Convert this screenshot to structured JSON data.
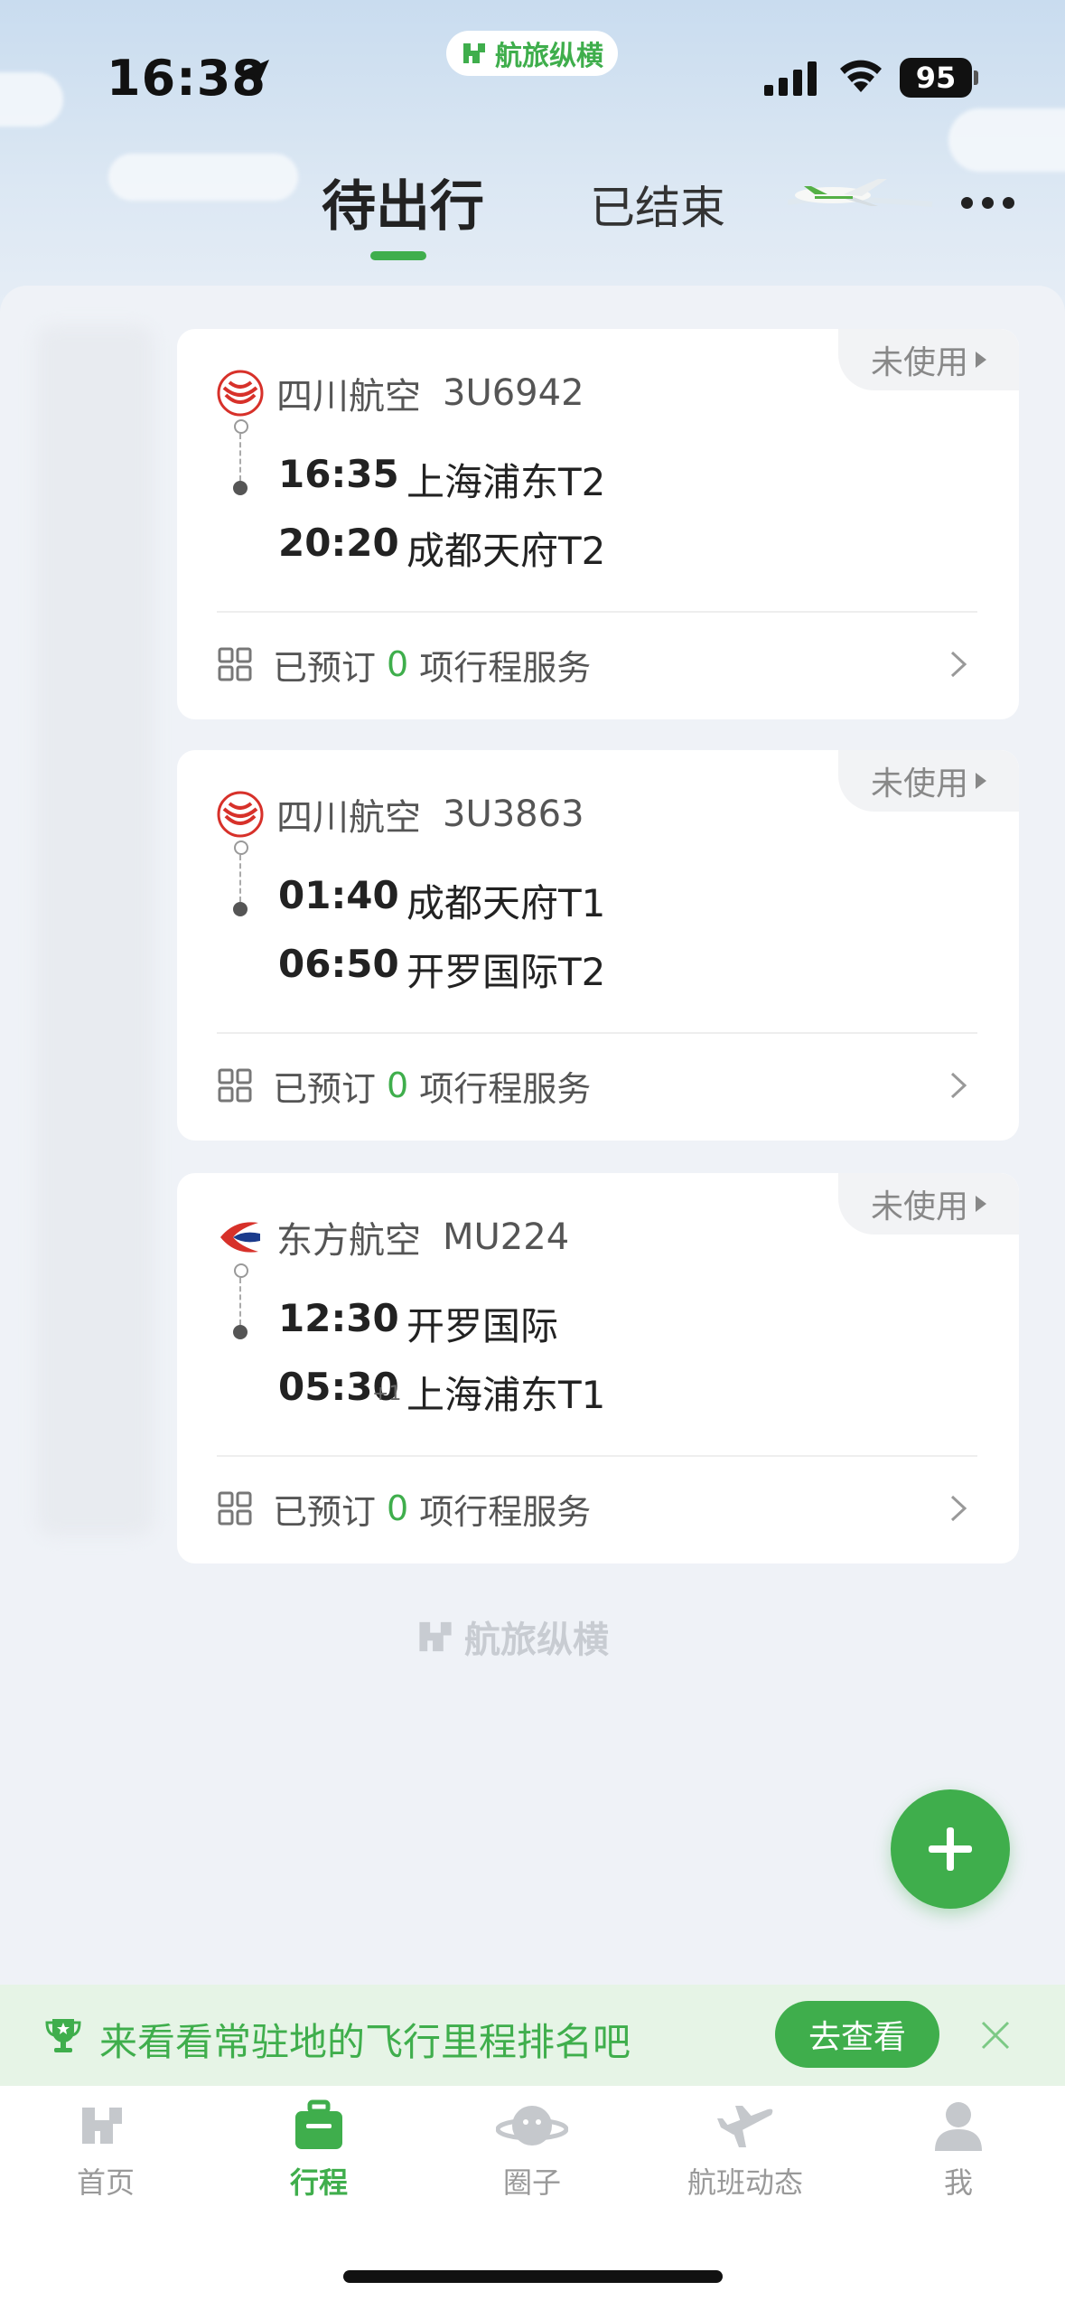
{
  "status_bar": {
    "time": "16:38",
    "battery": "95",
    "brand": "航旅纵横"
  },
  "tabs": [
    {
      "label": "待出行"
    },
    {
      "label": "已结束"
    }
  ],
  "trips": [
    {
      "airline": "四川航空",
      "flight_no": "3U6942",
      "status": "未使用",
      "dep_time": "16:35",
      "dep_airport": "上海浦东T2",
      "arr_time": "20:20",
      "arr_airport": "成都天府T2",
      "arr_day_offset": "",
      "svc_prefix": "已预订",
      "svc_count": "0",
      "svc_suffix": "项行程服务"
    },
    {
      "airline": "四川航空",
      "flight_no": "3U3863",
      "status": "未使用",
      "dep_time": "01:40",
      "dep_airport": "成都天府T1",
      "arr_time": "06:50",
      "arr_airport": "开罗国际T2",
      "arr_day_offset": "",
      "svc_prefix": "已预订",
      "svc_count": "0",
      "svc_suffix": "项行程服务"
    },
    {
      "airline": "东方航空",
      "flight_no": "MU224",
      "status": "未使用",
      "dep_time": "12:30",
      "dep_airport": "开罗国际",
      "arr_time": "05:30",
      "arr_airport": "上海浦东T1",
      "arr_day_offset": "+1",
      "svc_prefix": "已预订",
      "svc_count": "0",
      "svc_suffix": "项行程服务"
    }
  ],
  "watermark": "航旅纵横",
  "promo": {
    "text": "来看看常驻地的飞行里程排名吧",
    "button": "去查看"
  },
  "tabbar": [
    {
      "label": "首页",
      "icon": "home-icon"
    },
    {
      "label": "行程",
      "icon": "suitcase-icon"
    },
    {
      "label": "圈子",
      "icon": "planet-icon"
    },
    {
      "label": "航班动态",
      "icon": "plane-icon"
    },
    {
      "label": "我",
      "icon": "person-icon"
    }
  ],
  "colors": {
    "accent": "#3fae4c",
    "sichuan_red": "#d7312a",
    "eastern_blue": "#1b3b8c"
  }
}
